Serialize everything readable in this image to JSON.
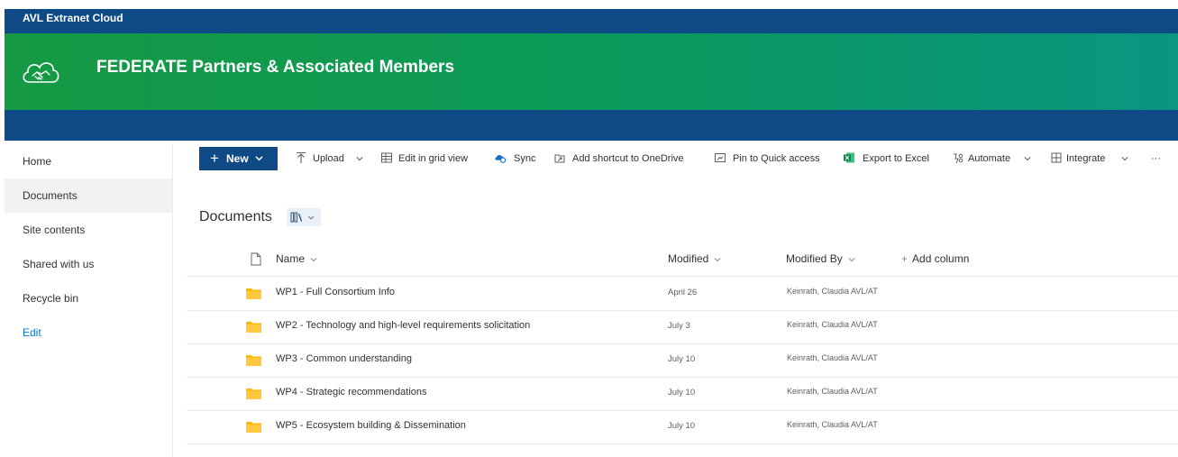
{
  "suite": {
    "title": "AVL Extranet Cloud"
  },
  "site": {
    "title": "FEDERATE Partners & Associated Members"
  },
  "nav": {
    "items": [
      {
        "label": "Home"
      },
      {
        "label": "Documents"
      },
      {
        "label": "Site contents"
      },
      {
        "label": "Shared with us"
      },
      {
        "label": "Recycle bin"
      },
      {
        "label": "Edit"
      }
    ],
    "selected": "Documents"
  },
  "commands": {
    "new": "New",
    "upload": "Upload",
    "edit_grid": "Edit in grid view",
    "sync": "Sync",
    "add_shortcut": "Add shortcut to OneDrive",
    "pin": "Pin to Quick access",
    "export": "Export to Excel",
    "automate": "Automate",
    "integrate": "Integrate",
    "more": "···"
  },
  "library": {
    "title": "Documents"
  },
  "columns": {
    "name": "Name",
    "modified": "Modified",
    "modified_by": "Modified By",
    "add_column": "Add column"
  },
  "rows": [
    {
      "name": "WP1 - Full Consortium Info",
      "modified": "April 26",
      "modified_by": "Keinrath, Claudia AVL/AT"
    },
    {
      "name": "WP2 - Technology and high-level requirements solicitation",
      "modified": "July 3",
      "modified_by": "Keinrath, Claudia AVL/AT"
    },
    {
      "name": "WP3 - Common understanding",
      "modified": "July 10",
      "modified_by": "Keinrath, Claudia AVL/AT"
    },
    {
      "name": "WP4 - Strategic recommendations",
      "modified": "July 10",
      "modified_by": "Keinrath, Claudia AVL/AT"
    },
    {
      "name": "WP5 - Ecosystem building & Dissemination",
      "modified": "July 10",
      "modified_by": "Keinrath, Claudia AVL/AT"
    }
  ],
  "colors": {
    "suite_bar": "#0e4a86",
    "header_green": "#159943",
    "header_teal": "#0b9582",
    "folder": "#ffb900",
    "link": "#0078d4"
  }
}
